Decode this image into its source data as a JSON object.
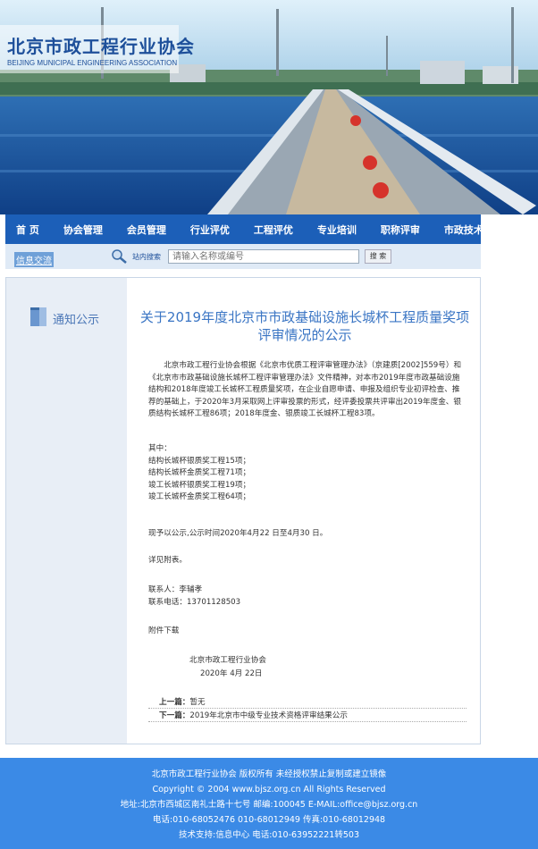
{
  "header": {
    "org_name_cn": "北京市政工程行业协会",
    "org_name_en": "BEIJING MUNICIPAL ENGINEERING ASSOCIATION"
  },
  "nav": {
    "items": [
      "首 页",
      "协会管理",
      "会员管理",
      "行业评优",
      "工程评优",
      "专业培训",
      "职称评审",
      "市政技术"
    ]
  },
  "subbar": {
    "link": "信息交流",
    "search_label": "站内搜索",
    "search_placeholder": "请输入名称或编号",
    "search_button": "搜 索"
  },
  "sidebar": {
    "section_title": "通知公示"
  },
  "article": {
    "title": "关于2019年度北京市市政基础设施长城杯工程质量奖项评审情况的公示",
    "intro": "北京市政工程行业协会根据《北京市优质工程评审管理办法》（京建质[2002]559号）和《北京市市政基础设施长城杯工程评审管理办法》文件精神，对本市2019年度市政基础设施结构和2018年度竣工长城杯工程质量奖项，在企业自愿申请、申报及组织专业初评检查、推荐的基础上，于2020年3月采取网上评审投票的形式，经评委投票共评审出2019年度金、银质结构长城杯工程86项；2018年度金、银质竣工长城杯工程83项。",
    "list_head": "其中：",
    "list_items": [
      "结构长城杯银质奖工程15项；",
      "结构长城杯金质奖工程71项；",
      "竣工长城杯银质奖工程19项；",
      "竣工长城杯金质奖工程64项；"
    ],
    "announce": "现予以公示,公示时间2020年4月22 日至4月30 日。",
    "see_attach": "详见附表。",
    "contact": "联系人：李辅孝",
    "phone": "联系电话：13701128503",
    "download": "附件下载",
    "signature_org": "北京市政工程行业协会",
    "signature_date": "2020年 4月 22日",
    "prev_label": "上一篇：",
    "prev_value": "暂无",
    "next_label": "下一篇：",
    "next_value": "2019年北京市中级专业技术资格评审结果公示"
  },
  "footer": {
    "lines": [
      "北京市政工程行业协会  版权所有 未经授权禁止复制或建立镜像",
      "Copyright © 2004 www.bjsz.org.cn All Rights Reserved",
      "地址:北京市西城区南礼士路十七号  邮编:100045  E-MAIL:office@bjsz.org.cn",
      "电话:010-68052476   010-68012949  传真:010-68012948",
      "技术支持:信息中心  电话:010-63952221转503"
    ]
  },
  "colors": {
    "nav_bg": "#1c5fb8",
    "title": "#3a75c4",
    "footer_bg": "#3b8ae6"
  }
}
